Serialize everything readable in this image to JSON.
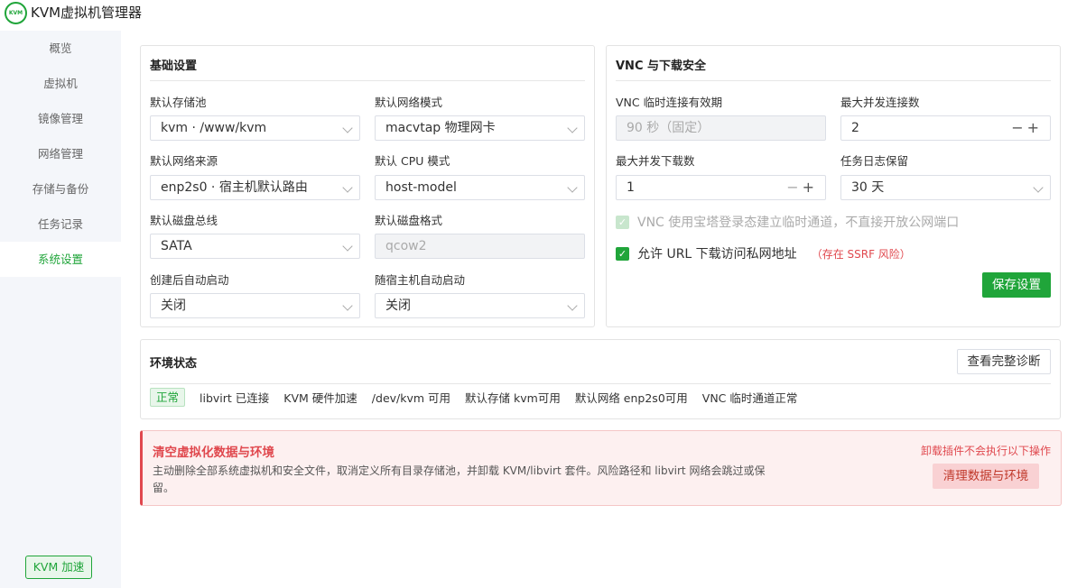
{
  "app": {
    "logo_text": "KVM",
    "title": "KVM虚拟机管理器"
  },
  "sidebar": {
    "items": [
      {
        "label": "概览"
      },
      {
        "label": "虚拟机"
      },
      {
        "label": "镜像管理"
      },
      {
        "label": "网络管理"
      },
      {
        "label": "存储与备份"
      },
      {
        "label": "任务记录"
      },
      {
        "label": "系统设置"
      }
    ],
    "active_index": 6,
    "badge": "KVM 加速"
  },
  "basic": {
    "title": "基础设置",
    "storage_pool": {
      "label": "默认存储池",
      "value": "kvm · /www/kvm"
    },
    "network_mode": {
      "label": "默认网络模式",
      "value": "macvtap 物理网卡"
    },
    "network_source": {
      "label": "默认网络来源",
      "value": "enp2s0 · 宿主机默认路由"
    },
    "cpu_mode": {
      "label": "默认 CPU 模式",
      "value": "host-model"
    },
    "disk_bus": {
      "label": "默认磁盘总线",
      "value": "SATA"
    },
    "disk_format": {
      "label": "默认磁盘格式",
      "value": "qcow2"
    },
    "autostart_after_create": {
      "label": "创建后自动启动",
      "value": "关闭"
    },
    "autostart_with_host": {
      "label": "随宿主机自动启动",
      "value": "关闭"
    }
  },
  "vnc": {
    "title": "VNC 与下载安全",
    "validity": {
      "label": "VNC 临时连接有效期",
      "value": "90 秒（固定）"
    },
    "max_connections": {
      "label": "最大并发连接数",
      "value": "2"
    },
    "max_downloads": {
      "label": "最大并发下载数",
      "value": "1"
    },
    "log_retention": {
      "label": "任务日志保留",
      "value": "30 天"
    },
    "tunnel_checkbox": {
      "label": "VNC 使用宝塔登录态建立临时通道，不直接开放公网端口",
      "checked": true,
      "disabled": true
    },
    "private_url_checkbox": {
      "label": "允许 URL 下载访问私网地址",
      "checked": true,
      "warning": "（存在 SSRF 风险）"
    },
    "save_button": "保存设置"
  },
  "env": {
    "title": "环境状态",
    "diagnose_button": "查看完整诊断",
    "status_badge": "正常",
    "items": [
      "libvirt 已连接",
      "KVM 硬件加速",
      "/dev/kvm 可用",
      "默认存储 kvm可用",
      "默认网络 enp2s0可用",
      "VNC 临时通道正常"
    ]
  },
  "danger": {
    "title": "清空虚拟化数据与环境",
    "description": "主动删除全部系统虚拟机和安全文件，取消定义所有目录存储池，并卸载 KVM/libvirt 套件。风险路径和 libvirt 网络会跳过或保留。",
    "note": "卸载插件不会执行以下操作",
    "button": "清理数据与环境"
  },
  "colors": {
    "accent": "#20a53a",
    "danger": "#e0484e",
    "sidebar_bg": "#f4f6fa"
  }
}
